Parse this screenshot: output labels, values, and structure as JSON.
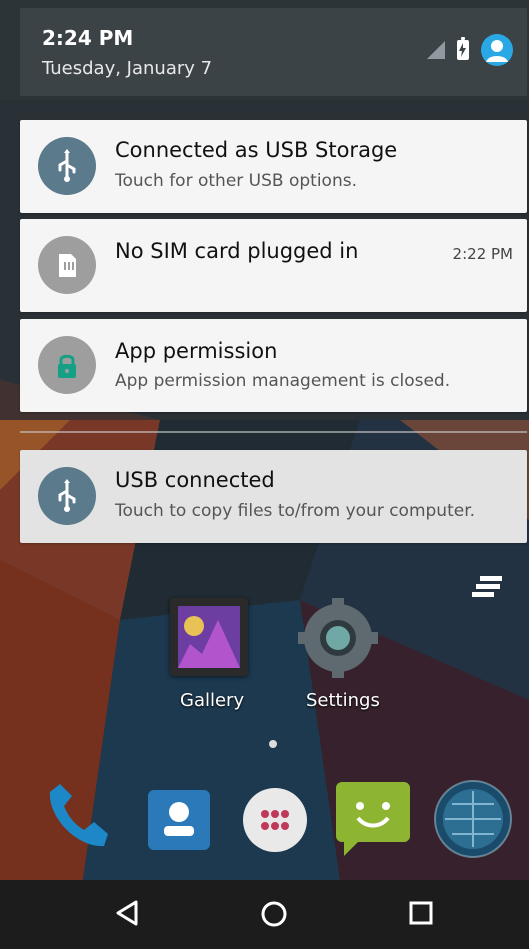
{
  "status": {
    "time": "2:24 PM",
    "date": "Tuesday, January 7"
  },
  "notifications": [
    {
      "title": "Connected as USB Storage",
      "subtitle": "Touch for other USB options.",
      "icon": "usb-icon"
    },
    {
      "title": "No SIM card plugged in",
      "time": "2:22 PM",
      "icon": "sim-card-icon"
    },
    {
      "title": "App permission",
      "subtitle": "App permission management is closed.",
      "icon": "lock-icon"
    },
    {
      "title": "USB connected",
      "subtitle": "Touch to copy files to/from your computer.",
      "icon": "usb-icon"
    }
  ],
  "home": {
    "apps": [
      {
        "label": "Gallery",
        "icon": "gallery-icon"
      },
      {
        "label": "Settings",
        "icon": "settings-icon"
      }
    ],
    "dock": [
      "phone-icon",
      "contacts-icon",
      "app-drawer-icon",
      "messaging-icon",
      "browser-icon"
    ]
  },
  "nav": {
    "back": "back-icon",
    "home": "home-icon",
    "recents": "recents-icon"
  },
  "colors": {
    "statusbar": "#3b4347",
    "card": "#f5f5f5",
    "highlight_card": "#e3e3e3",
    "usb_icon_bg": "#5b7a8c",
    "sim_icon_bg": "#9e9e9e",
    "lock_icon_bg": "#9e9e9e",
    "lock_icon_color": "#14a085"
  }
}
